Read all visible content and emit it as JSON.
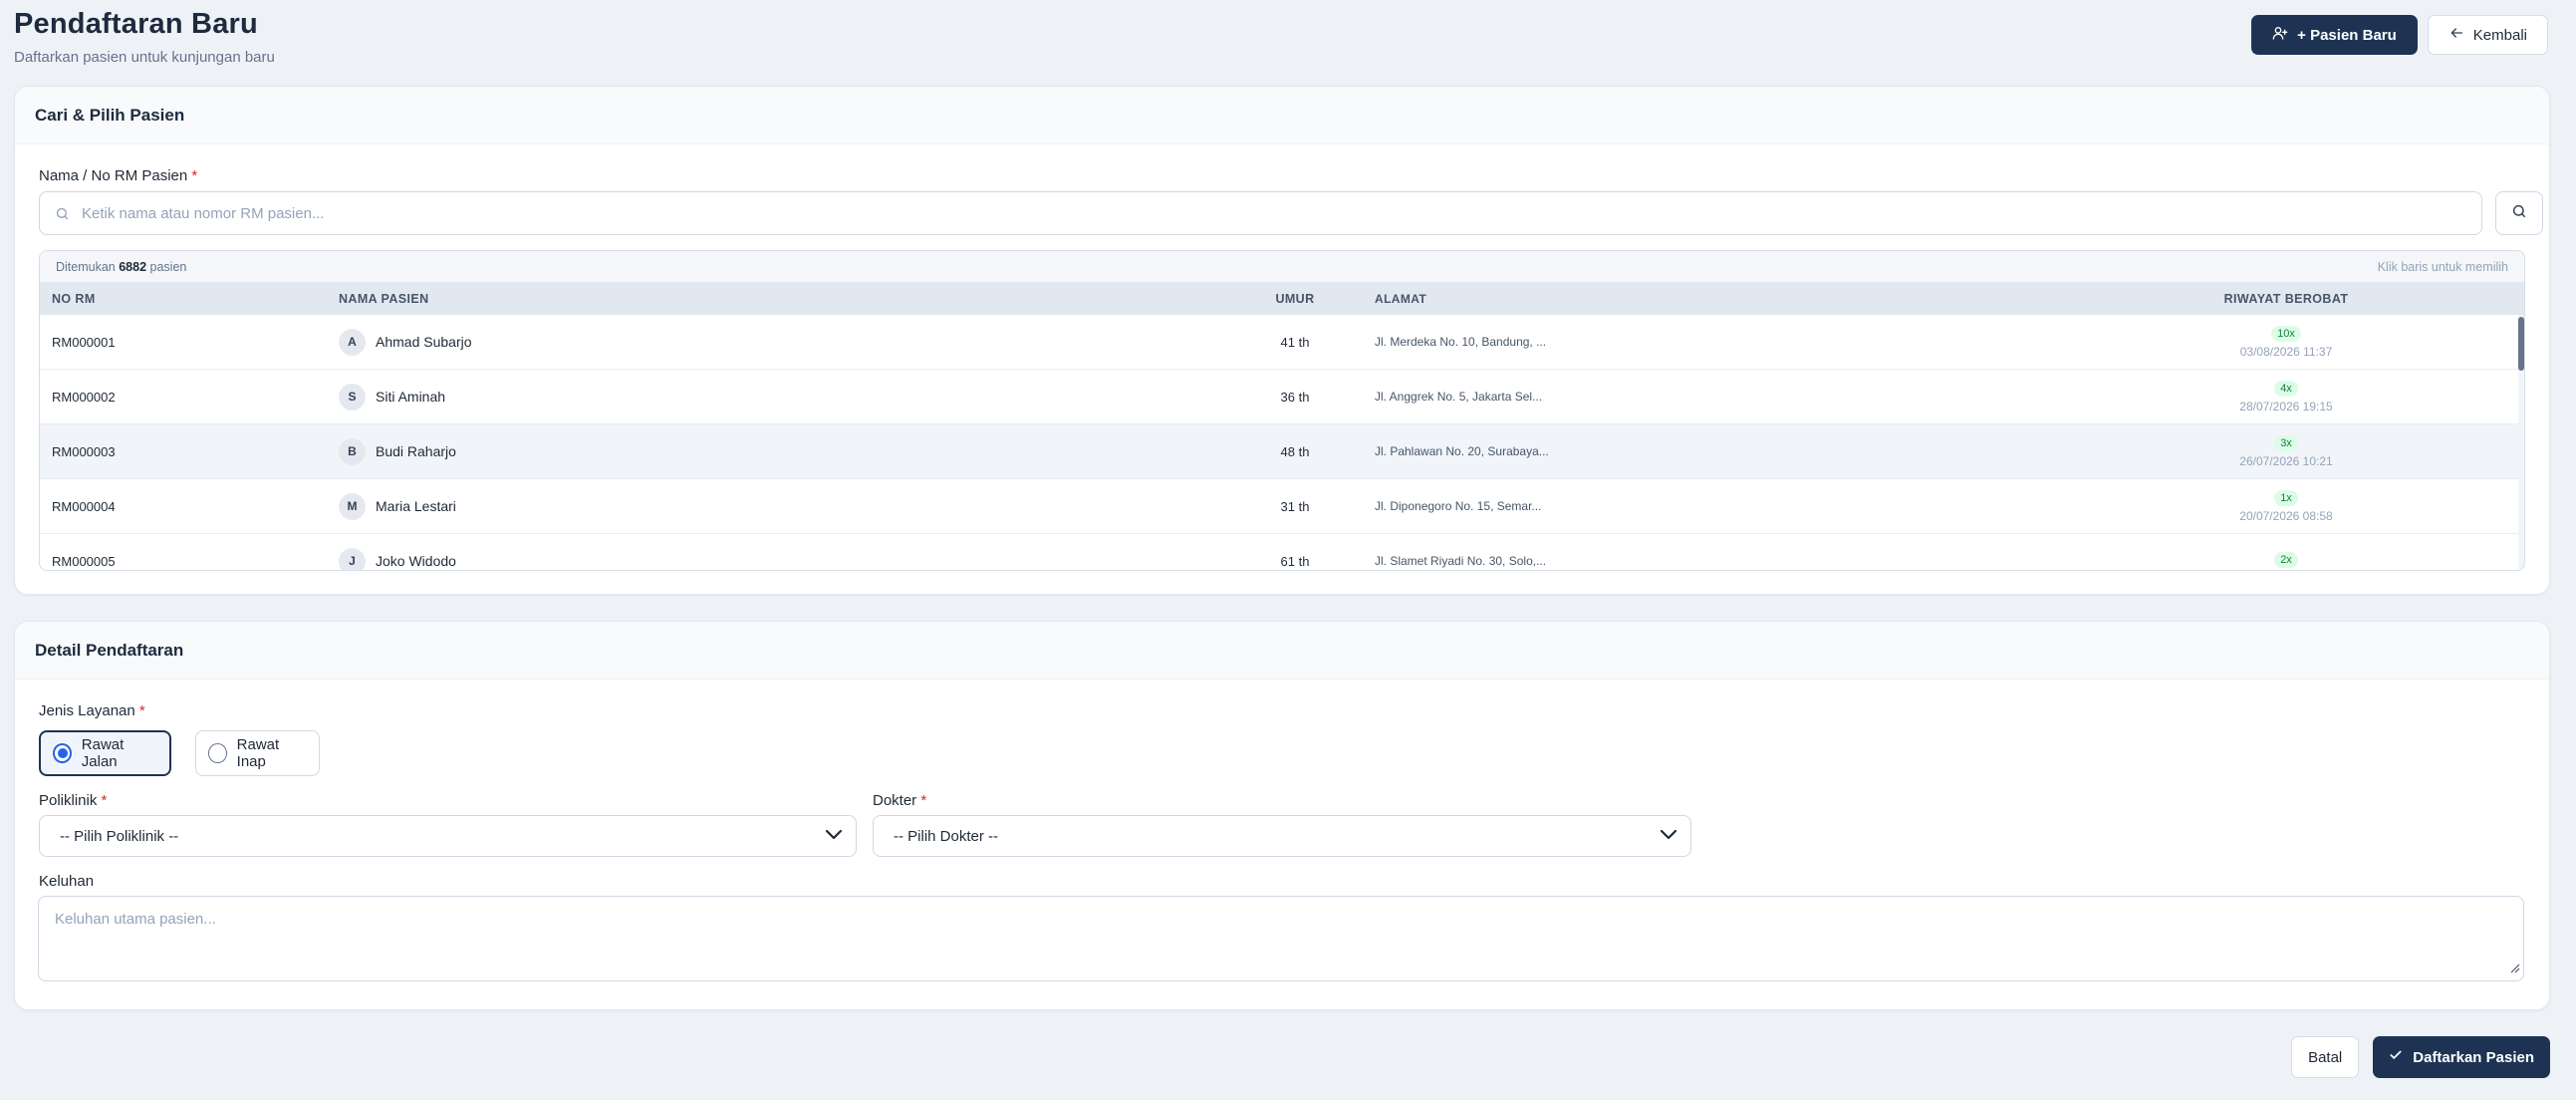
{
  "header": {
    "title": "Pendaftaran Baru",
    "subtitle": "Daftarkan pasien untuk kunjungan baru",
    "new_patient_label": "+ Pasien Baru",
    "back_label": "Kembali"
  },
  "search_card": {
    "title": "Cari & Pilih Pasien",
    "field_label": "Nama / No RM Pasien",
    "placeholder": "Ketik nama atau nomor RM pasien...",
    "found_prefix": "Ditemukan",
    "found_count": "6882",
    "found_suffix": "pasien",
    "hint": "Klik baris untuk memilih",
    "columns": [
      "NO RM",
      "NAMA PASIEN",
      "UMUR",
      "ALAMAT",
      "RIWAYAT BEROBAT"
    ],
    "rows": [
      {
        "rm": "RM000001",
        "initial": "A",
        "name": "Ahmad Subarjo",
        "age": "41 th",
        "address": "Jl. Merdeka No. 10, Bandung, ...",
        "visits": "10x",
        "last": "03/08/2026 11:37"
      },
      {
        "rm": "RM000002",
        "initial": "S",
        "name": "Siti Aminah",
        "age": "36 th",
        "address": "Jl. Anggrek No. 5, Jakarta Sel...",
        "visits": "4x",
        "last": "28/07/2026 19:15"
      },
      {
        "rm": "RM000003",
        "initial": "B",
        "name": "Budi Raharjo",
        "age": "48 th",
        "address": "Jl. Pahlawan No. 20, Surabaya...",
        "visits": "3x",
        "last": "26/07/2026 10:21"
      },
      {
        "rm": "RM000004",
        "initial": "M",
        "name": "Maria Lestari",
        "age": "31 th",
        "address": "Jl. Diponegoro No. 15, Semar...",
        "visits": "1x",
        "last": "20/07/2026 08:58"
      },
      {
        "rm": "RM000005",
        "initial": "J",
        "name": "Joko Widodo",
        "age": "61 th",
        "address": "Jl. Slamet Riyadi No. 30, Solo,...",
        "visits": "2x",
        "last": ""
      }
    ]
  },
  "detail_card": {
    "title": "Detail Pendaftaran",
    "service_label": "Jenis Layanan",
    "option_outpatient": "Rawat Jalan",
    "option_inpatient": "Rawat Inap",
    "clinic_label": "Poliklinik",
    "clinic_value": "-- Pilih Poliklinik --",
    "doctor_label": "Dokter",
    "doctor_value": "-- Pilih Dokter --",
    "complaint_label": "Keluhan",
    "complaint_placeholder": "Keluhan utama pasien..."
  },
  "footer": {
    "cancel_label": "Batal",
    "submit_label": "Daftarkan Pasien"
  },
  "colors": {
    "primary": "#1e3354",
    "accent": "#2563eb",
    "badge": "#dcfce7"
  }
}
